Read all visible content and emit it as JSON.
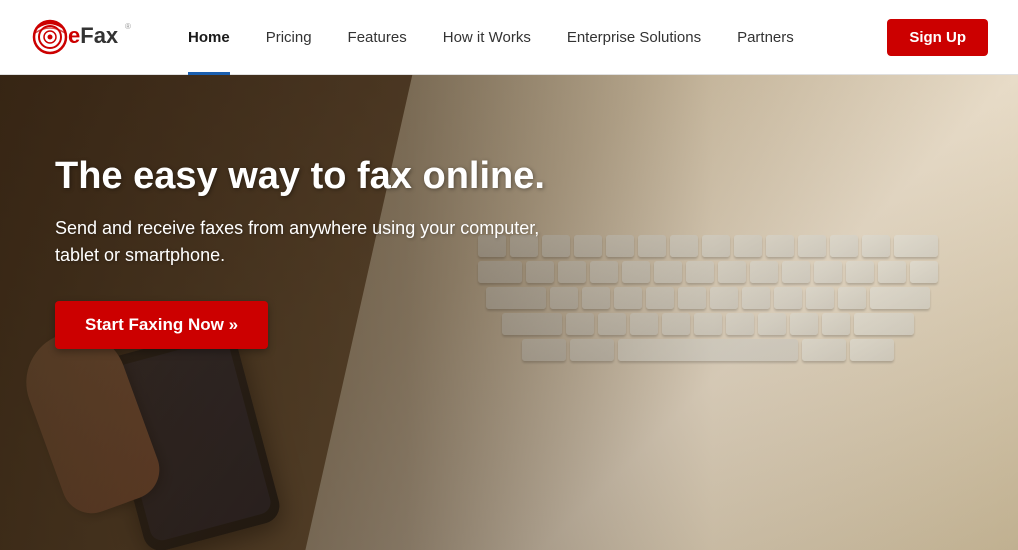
{
  "navbar": {
    "logo_text": "eFax",
    "nav_items": [
      {
        "id": "home",
        "label": "Home",
        "active": true
      },
      {
        "id": "pricing",
        "label": "Pricing",
        "active": false
      },
      {
        "id": "features",
        "label": "Features",
        "active": false
      },
      {
        "id": "how-it-works",
        "label": "How it Works",
        "active": false
      },
      {
        "id": "enterprise",
        "label": "Enterprise Solutions",
        "active": false
      },
      {
        "id": "partners",
        "label": "Partners",
        "active": false
      }
    ],
    "signup_label": "Sign Up"
  },
  "hero": {
    "title": "The easy way to fax online.",
    "subtitle": "Send and receive faxes from anywhere using your computer, tablet or smartphone.",
    "cta_label": "Start Faxing Now »"
  }
}
